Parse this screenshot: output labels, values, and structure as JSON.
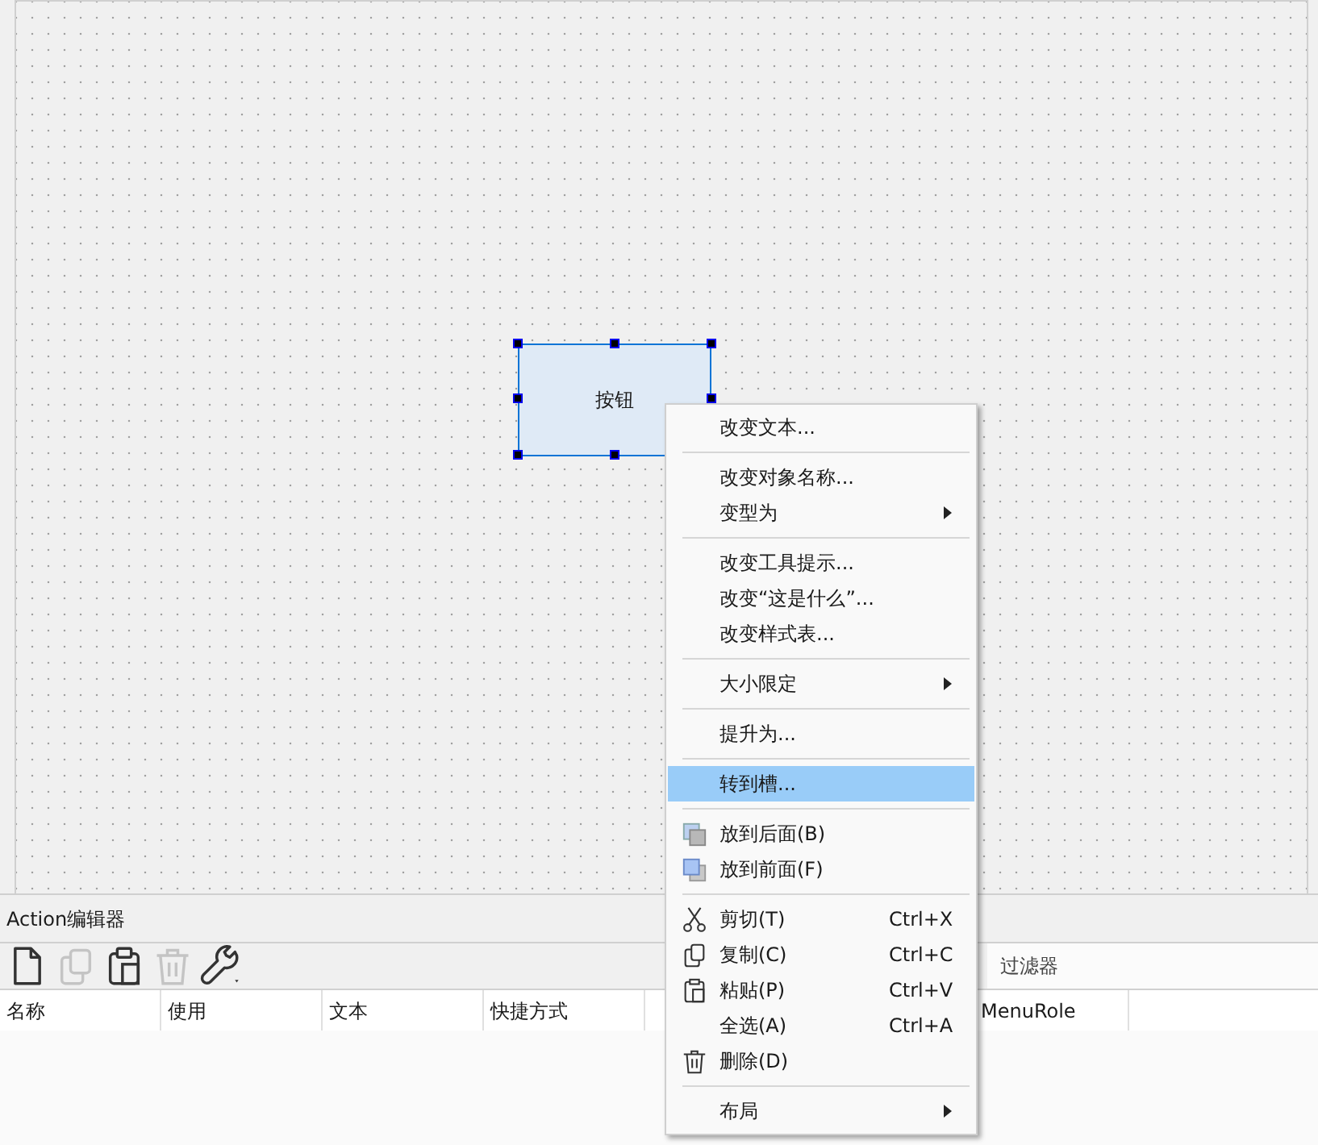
{
  "form_widget": {
    "label": "按钮",
    "selected": true
  },
  "action_editor": {
    "title": "Action编辑器",
    "toolbar": [
      {
        "kind": "new",
        "disabled": false
      },
      {
        "kind": "copy",
        "disabled": true
      },
      {
        "kind": "paste",
        "disabled": false
      },
      {
        "kind": "delete",
        "disabled": true
      },
      {
        "kind": "configure",
        "disabled": false
      }
    ],
    "filter": {
      "placeholder": "过滤器"
    },
    "columns": [
      {
        "label": "名称"
      },
      {
        "label": "使用"
      },
      {
        "label": "文本"
      },
      {
        "label": "快捷方式"
      },
      {},
      {},
      {
        "label": "MenuRole"
      }
    ]
  },
  "context_menu": [
    {
      "kind": "item",
      "label": "改变文本...",
      "selected": false
    },
    {
      "kind": "separator"
    },
    {
      "kind": "item",
      "label": "改变对象名称...",
      "selected": false
    },
    {
      "kind": "item",
      "label": "变型为",
      "submenu": true,
      "selected": false
    },
    {
      "kind": "separator"
    },
    {
      "kind": "item",
      "label": "改变工具提示...",
      "selected": false
    },
    {
      "kind": "item",
      "label": "改变“这是什么”...",
      "selected": false
    },
    {
      "kind": "item",
      "label": "改变样式表...",
      "selected": false
    },
    {
      "kind": "separator"
    },
    {
      "kind": "item",
      "label": "大小限定",
      "submenu": true,
      "selected": false
    },
    {
      "kind": "separator"
    },
    {
      "kind": "item",
      "label": "提升为...",
      "selected": false
    },
    {
      "kind": "separator"
    },
    {
      "kind": "item",
      "label": "转到槽...",
      "selected": true
    },
    {
      "kind": "separator"
    },
    {
      "kind": "back",
      "label": "放到后面(B)",
      "selected": false
    },
    {
      "kind": "front",
      "label": "放到前面(F)",
      "selected": false
    },
    {
      "kind": "separator"
    },
    {
      "kind": "cut",
      "label": "剪切(T)",
      "shortcut": "Ctrl+X",
      "selected": false
    },
    {
      "kind": "copy",
      "label": "复制(C)",
      "shortcut": "Ctrl+C",
      "selected": false
    },
    {
      "kind": "paste",
      "label": "粘贴(P)",
      "shortcut": "Ctrl+V",
      "selected": false
    },
    {
      "kind": "item",
      "label": "全选(A)",
      "shortcut": "Ctrl+A",
      "selected": false
    },
    {
      "kind": "delete",
      "label": "删除(D)",
      "selected": false
    },
    {
      "kind": "separator"
    },
    {
      "kind": "item",
      "label": "布局",
      "submenu": true,
      "selected": false
    }
  ]
}
